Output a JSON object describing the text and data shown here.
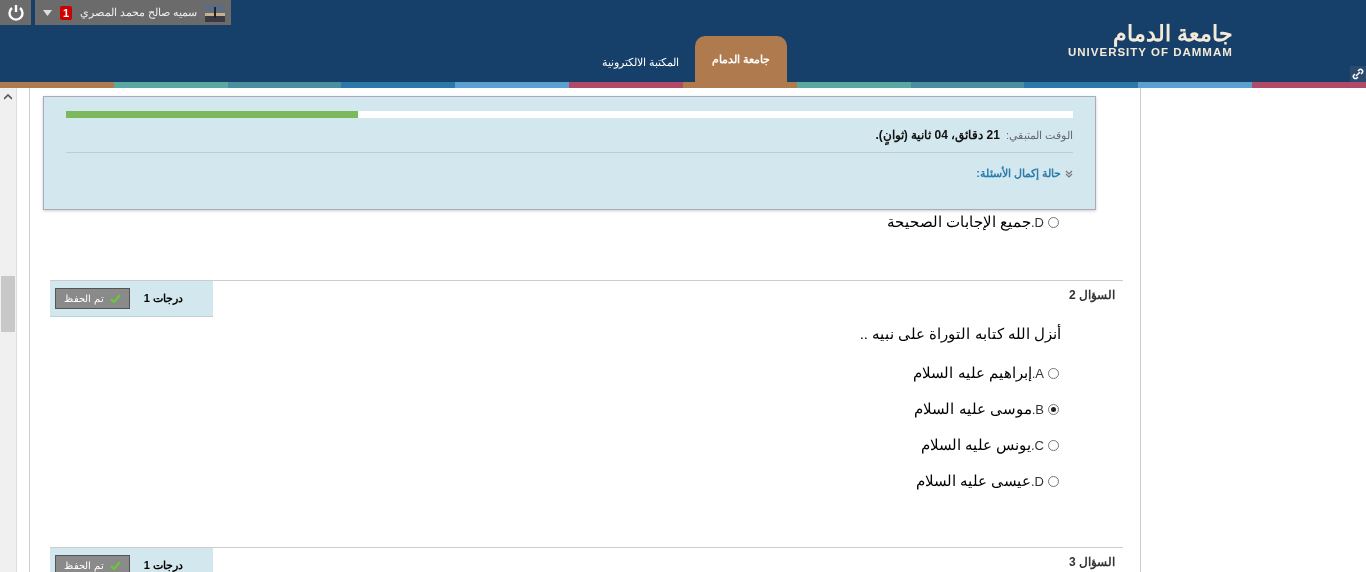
{
  "top_bar": {
    "user_name": "سميه صالح محمد المصري",
    "notification_count": "1"
  },
  "logo": {
    "arabic": "جامعة الدمام",
    "english": "UNIVERSITY OF DAMMAM"
  },
  "tabs": [
    {
      "label": "جامعة الدمام",
      "selected": true
    },
    {
      "label": "المكتبة الالكترونية",
      "selected": false
    }
  ],
  "timer": {
    "level": 0.29,
    "label": "الوقت المتبقي:",
    "value": "21 دقائق، 04 ثانية (ثوانٍ).",
    "status_link": "حالة إكمال الأسئلة:"
  },
  "questions": [
    {
      "options": [
        {
          "letter": "D.",
          "text": "جميع الإجابات الصحيحة",
          "selected": false
        }
      ]
    },
    {
      "title": "السؤال 2",
      "points": "1 درجات",
      "save_state": "تم الحفظ",
      "text": "أنزل الله كتابه التوراة على نبيه ..",
      "options": [
        {
          "letter": "A.",
          "text": "إبراهيم عليه السلام",
          "selected": false
        },
        {
          "letter": "B.",
          "text": "موسى عليه السلام",
          "selected": true
        },
        {
          "letter": "C.",
          "text": "يونس عليه السلام",
          "selected": false
        },
        {
          "letter": "D.",
          "text": "عيسى عليه السلام",
          "selected": false
        }
      ]
    },
    {
      "title": "السؤال 3",
      "points": "1 درجات",
      "save_state": "تم الحفظ"
    }
  ]
}
